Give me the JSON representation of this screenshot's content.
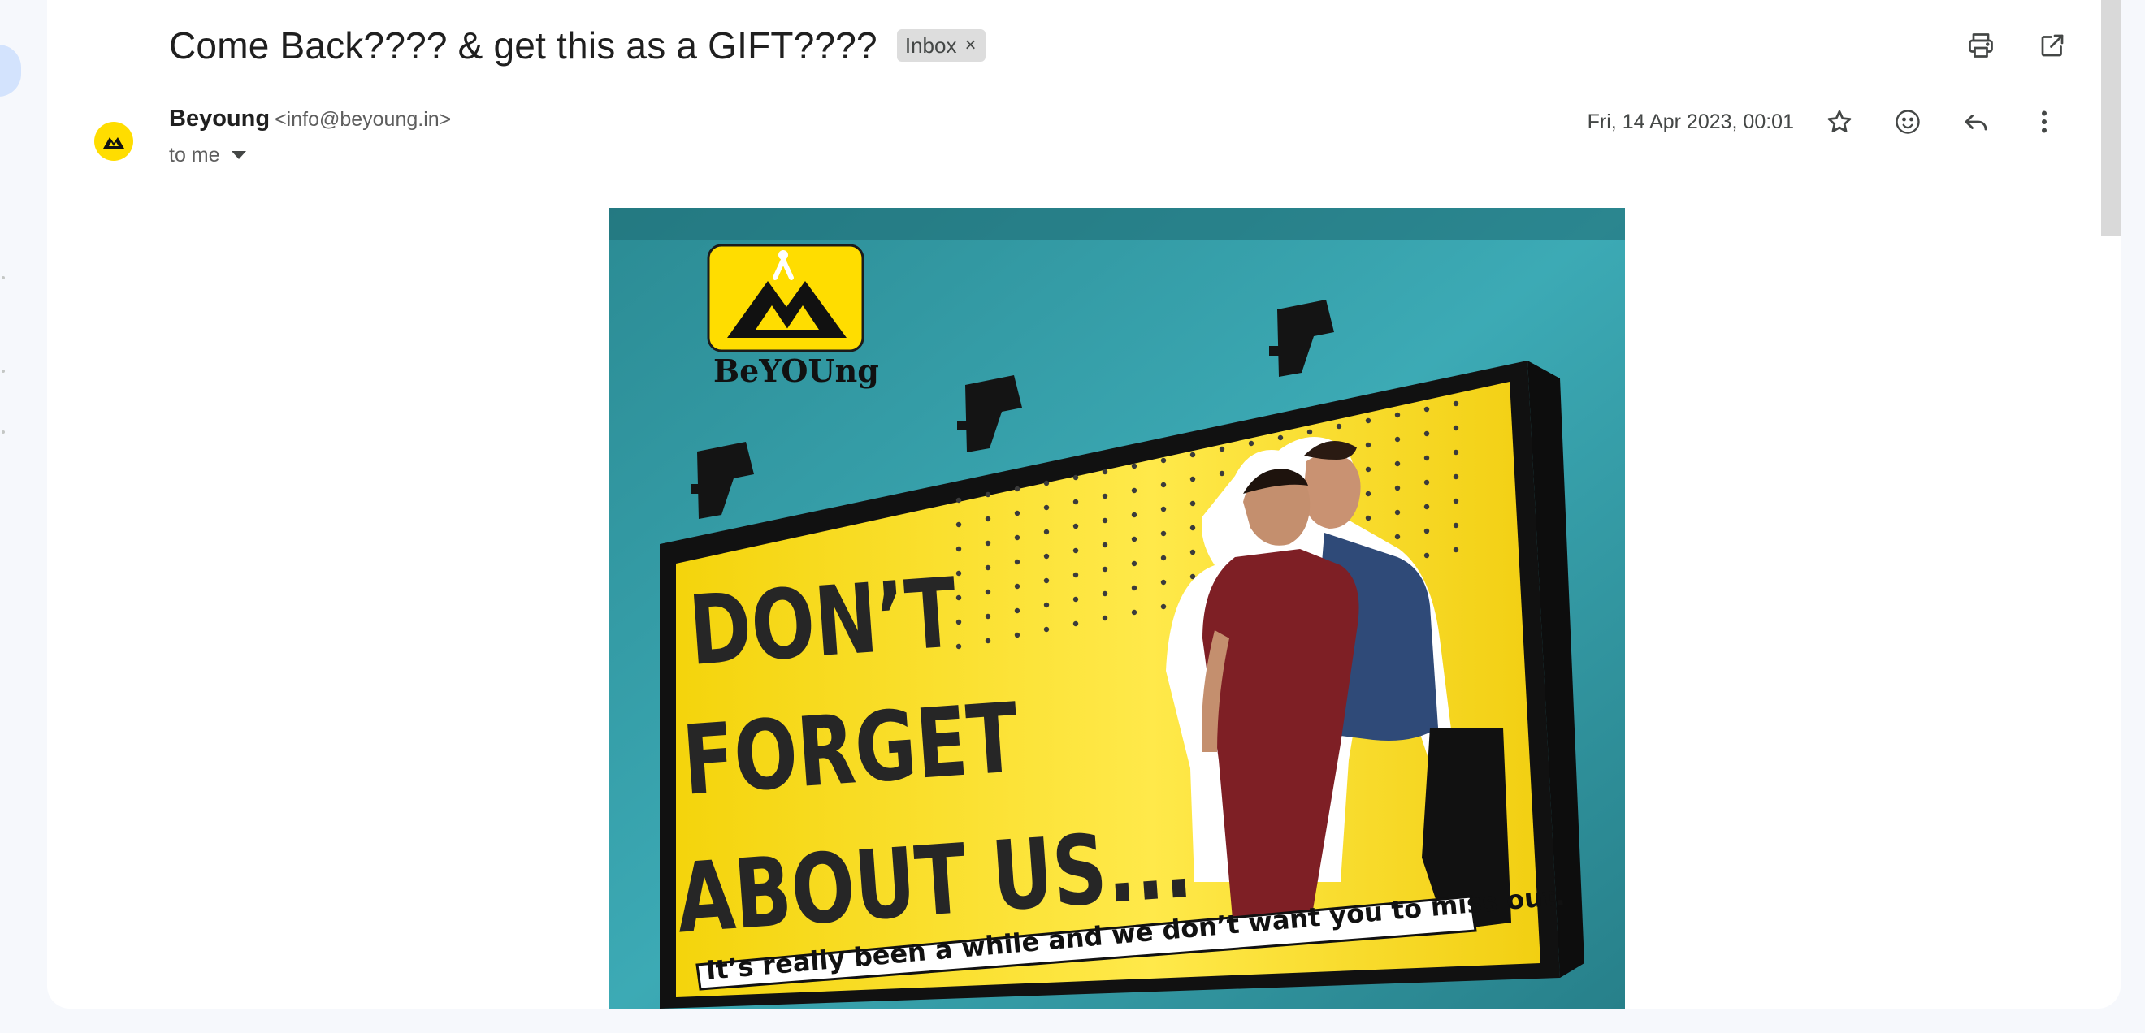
{
  "email": {
    "subject": "Come Back???? & get this as a GIFT????",
    "label": "Inbox",
    "label_remove": "×",
    "sender_name": "Beyoung",
    "sender_email": "<info@beyoung.in>",
    "recipient": "to me",
    "date": "Fri, 14 Apr 2023, 00:01"
  },
  "banner": {
    "logo_text": "BeYOUng",
    "headline_line1": "DON’T",
    "headline_line2": "FORGET",
    "headline_line3": "ABOUT US...",
    "tagline": "It’s really been a while and we don’t want you to miss out."
  },
  "icons": {
    "print": "print-icon",
    "open_new": "open-in-new-icon",
    "star": "star-icon",
    "emoji": "emoji-icon",
    "reply": "reply-icon",
    "more": "more-vert-icon"
  },
  "colors": {
    "brand_yellow": "#ffdd00",
    "teal_background": "#3aa9b4",
    "card_background": "#ffffff"
  }
}
